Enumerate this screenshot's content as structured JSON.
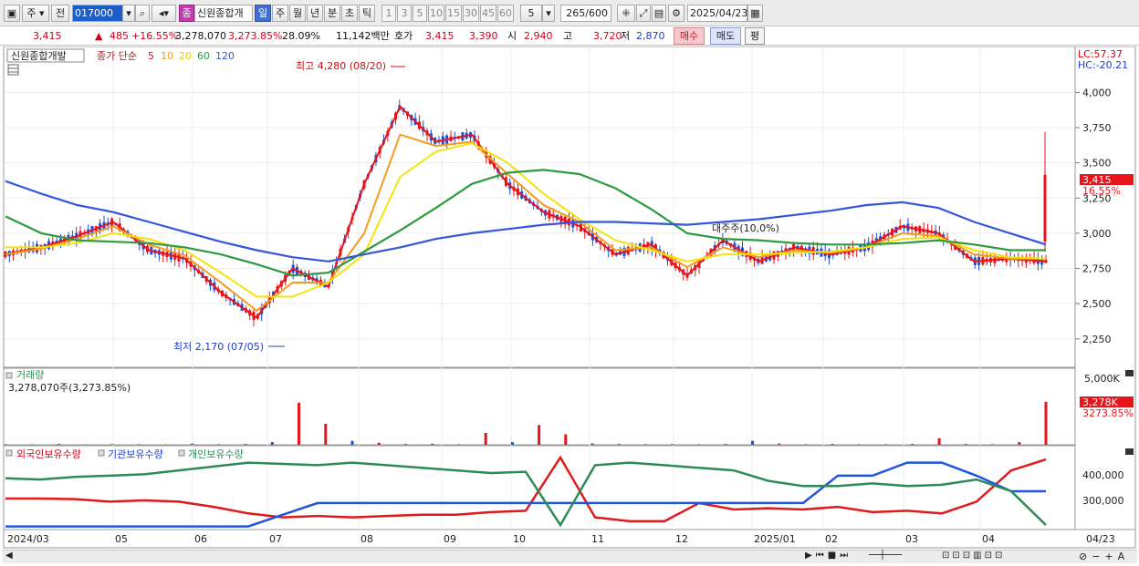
{
  "toolbar": {
    "market_type": "주",
    "prev_label": "전",
    "code": "017000",
    "name_badge": "종",
    "stock_name": "신원종합개",
    "periods": [
      "일",
      "주",
      "월",
      "년",
      "분",
      "초",
      "틱"
    ],
    "active_period": "일",
    "intervals": [
      "1",
      "3",
      "5",
      "10",
      "15",
      "30",
      "45",
      "60"
    ],
    "interval_value": "5",
    "count": "265",
    "count_total": "/600",
    "date": "2025/04/23"
  },
  "quote": {
    "price": "3,415",
    "change": "485",
    "change_pct": "+16.55%",
    "volume": "3,278,070",
    "volume_pct": "3,273.85%",
    "turnover": "28.09%",
    "amount": "11,142백만",
    "ask_label": "호가",
    "ask": "3,415",
    "bid": "3,390",
    "open_label": "시",
    "open": "2,940",
    "high_label": "고",
    "high": "3,720",
    "low_label": "저",
    "low": "2,870",
    "buy_button": "매수",
    "sell_button": "매도",
    "eval_button": "평"
  },
  "price_panel": {
    "stock_label": "신원종합개발",
    "ma_prefix": "종가 단순",
    "ma_periods": [
      "5",
      "10",
      "20",
      "60",
      "120"
    ],
    "max_annotation": "최고 4,280 (08/20)",
    "min_annotation": "최저 2,170 (07/05)",
    "inline_label": "대주주(10,0%)",
    "lc": "LC:57.37",
    "hc": "HC:-20.21",
    "price_tag": "3,415",
    "pct_tag": "16.55%",
    "y_ticks": [
      "4,000",
      "3,750",
      "3,500",
      "3,250",
      "3,000",
      "2,750",
      "2,500",
      "2,250"
    ]
  },
  "volume_panel": {
    "title": "거래량",
    "value_text": "3,278,070주(3,273.85%)",
    "y_tick": "5,000K",
    "tag": "3,278K",
    "tag_pct": "3273.85%"
  },
  "holding_panel": {
    "series_labels": [
      "외국인보유수량",
      "기관보유수량",
      "개인보유수량"
    ],
    "y_ticks": [
      "400,000",
      "300,000"
    ]
  },
  "x_axis": [
    "2024/03",
    "05",
    "06",
    "07",
    "08",
    "09",
    "10",
    "11",
    "12",
    "2025/01",
    "02",
    "03",
    "04",
    "04/23"
  ],
  "colors": {
    "up": "#e8141b",
    "down": "#1f4fd6",
    "ma5": "#e8141b",
    "ma10": "#f49b1f",
    "ma20": "#f2e40a",
    "ma60": "#2e9a3f",
    "ma120": "#3357d9"
  },
  "chart_data": [
    {
      "type": "line",
      "title": "신원종합개발",
      "ylim": [
        2100,
        4300
      ],
      "series": [
        {
          "name": "5",
          "values": [
            2850,
            2900,
            2980,
            3080,
            2880,
            2820,
            2580,
            2400,
            2750,
            2620,
            3350,
            3900,
            3650,
            3700,
            3350,
            3150,
            3050,
            2850,
            2920,
            2700,
            2950,
            2800,
            2900,
            2850,
            2900,
            3050,
            3000,
            2800,
            2820,
            2800
          ]
        },
        {
          "name": "10",
          "values": [
            2850,
            2890,
            2960,
            3050,
            2920,
            2840,
            2650,
            2450,
            2650,
            2650,
            3000,
            3700,
            3620,
            3650,
            3420,
            3200,
            3080,
            2880,
            2900,
            2760,
            2900,
            2830,
            2880,
            2860,
            2900,
            3000,
            2980,
            2850,
            2820,
            2820
          ]
        },
        {
          "name": "20",
          "values": [
            2900,
            2900,
            2930,
            3000,
            2960,
            2880,
            2720,
            2550,
            2550,
            2650,
            2850,
            3400,
            3580,
            3640,
            3500,
            3280,
            3100,
            2950,
            2880,
            2800,
            2850,
            2850,
            2860,
            2870,
            2900,
            2960,
            2970,
            2880,
            2830,
            2820
          ]
        },
        {
          "name": "60",
          "values": [
            3120,
            3000,
            2950,
            2940,
            2930,
            2900,
            2850,
            2780,
            2700,
            2720,
            2870,
            3020,
            3180,
            3350,
            3430,
            3450,
            3420,
            3320,
            3170,
            3000,
            2960,
            2950,
            2930,
            2920,
            2920,
            2930,
            2950,
            2920,
            2880,
            2880
          ]
        },
        {
          "name": "120",
          "values": [
            3370,
            3280,
            3200,
            3150,
            3080,
            3010,
            2940,
            2880,
            2830,
            2800,
            2850,
            2900,
            2960,
            3000,
            3030,
            3060,
            3080,
            3080,
            3070,
            3060,
            3080,
            3100,
            3130,
            3160,
            3200,
            3220,
            3180,
            3080,
            3000,
            2920
          ]
        }
      ]
    },
    {
      "type": "bar",
      "title": "거래량",
      "ylim": [
        0,
        5000
      ],
      "values": [
        40,
        30,
        60,
        30,
        50,
        40,
        30,
        90,
        40,
        60,
        200,
        3200,
        1600,
        300,
        150,
        60,
        80,
        40,
        900,
        200,
        1500,
        800,
        100,
        60,
        40,
        50,
        40,
        60,
        300,
        100,
        40,
        60,
        40,
        40,
        60,
        500,
        60,
        40,
        200,
        3278
      ]
    },
    {
      "type": "line",
      "title": "외국인보유수량",
      "ylim": [
        200000,
        480000
      ],
      "series": [
        {
          "name": "외국인보유수량",
          "values": [
            312000,
            312000,
            310000,
            300000,
            305000,
            300000,
            280000,
            255000,
            240000,
            245000,
            240000,
            245000,
            250000,
            250000,
            260000,
            265000,
            470000,
            240000,
            225000,
            225000,
            295000,
            270000,
            275000,
            270000,
            280000,
            260000,
            265000,
            255000,
            300000,
            420000,
            462000
          ]
        },
        {
          "name": "기관보유수량",
          "values": [
            205000,
            205000,
            205000,
            205000,
            205000,
            205000,
            205000,
            205000,
            250000,
            295000,
            295000,
            295000,
            295000,
            295000,
            295000,
            295000,
            295000,
            295000,
            295000,
            295000,
            295000,
            295000,
            295000,
            295000,
            400000,
            400000,
            450000,
            450000,
            400000,
            340000,
            340000
          ]
        },
        {
          "name": "개인보유수량",
          "values": [
            390000,
            385000,
            395000,
            400000,
            405000,
            420000,
            435000,
            450000,
            445000,
            440000,
            450000,
            440000,
            430000,
            420000,
            410000,
            415000,
            210000,
            440000,
            450000,
            440000,
            430000,
            420000,
            380000,
            360000,
            360000,
            370000,
            360000,
            365000,
            385000,
            340000,
            210000
          ]
        }
      ]
    }
  ]
}
